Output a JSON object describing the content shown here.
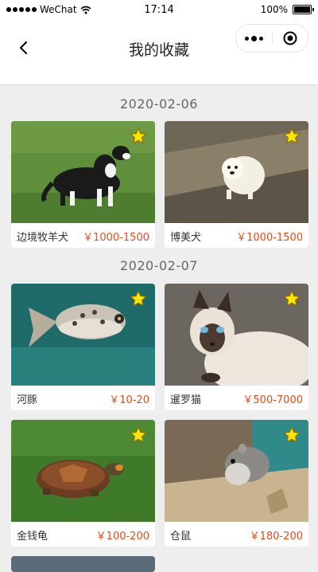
{
  "status_bar": {
    "carrier": "WeChat",
    "time": "17:14",
    "battery": "100%"
  },
  "nav": {
    "title": "我的收藏"
  },
  "groups": [
    {
      "date": "2020-02-06",
      "items": [
        {
          "name": "边境牧羊犬",
          "price": "￥1000-1500",
          "image": "border-collie-photo"
        },
        {
          "name": "博美犬",
          "price": "￥1000-1500",
          "image": "pomeranian-photo"
        }
      ]
    },
    {
      "date": "2020-02-07",
      "items": [
        {
          "name": "河豚",
          "price": "￥10-20",
          "image": "pufferfish-photo"
        },
        {
          "name": "暹罗猫",
          "price": "￥500-7000",
          "image": "siamese-cat-photo"
        },
        {
          "name": "金钱龟",
          "price": "￥100-200",
          "image": "turtle-photo"
        },
        {
          "name": "仓鼠",
          "price": "￥180-200",
          "image": "hamster-photo"
        }
      ]
    }
  ],
  "colors": {
    "price": "#e64a19",
    "star": "#ffe600",
    "background": "#eeeeee"
  }
}
